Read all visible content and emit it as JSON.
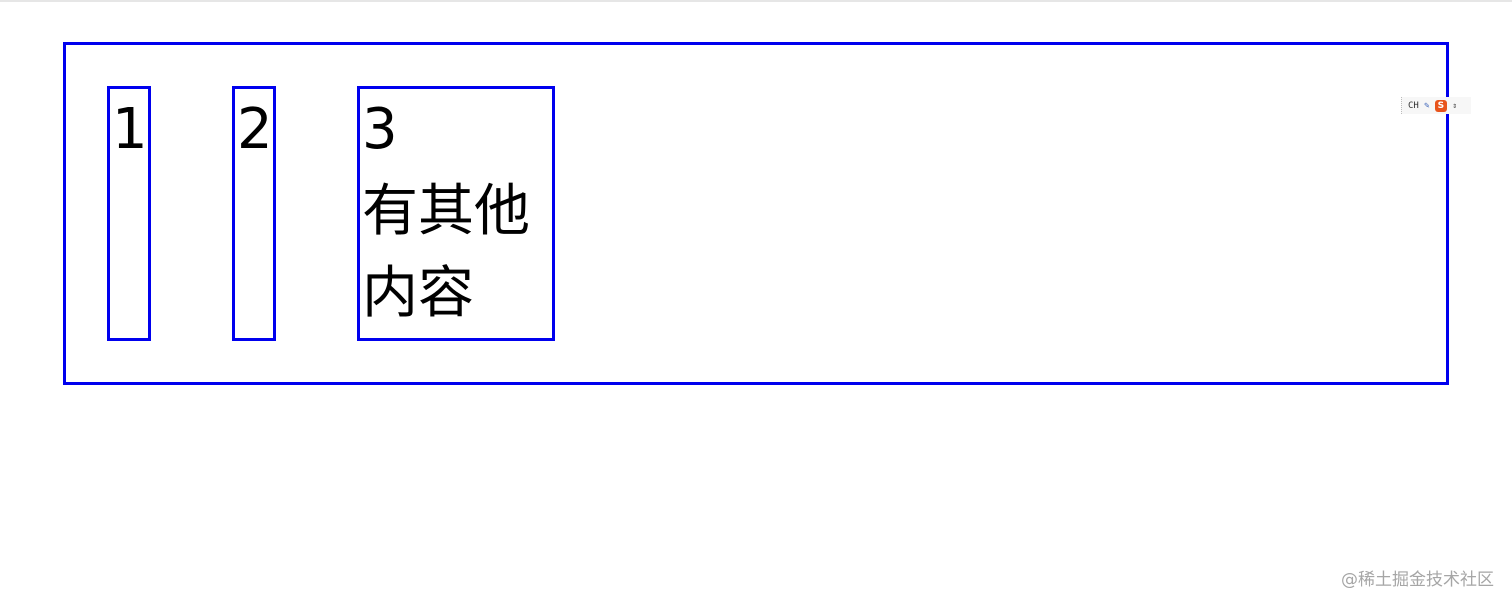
{
  "flex_items": [
    {
      "lines": [
        "1"
      ]
    },
    {
      "lines": [
        "2"
      ]
    },
    {
      "lines": [
        "3",
        "有其他",
        "内容"
      ]
    }
  ],
  "ime_toolbar": {
    "language": "CH",
    "icons": [
      "pen-icon",
      "sogou-logo-icon",
      "more-arrows-icon"
    ],
    "logo_letter": "S"
  },
  "watermark": "@稀土掘金技术社区",
  "colors": {
    "border": "#0000ee",
    "text": "#000000",
    "watermark": "#a6a6a6",
    "ime_logo": "#e8541c"
  }
}
